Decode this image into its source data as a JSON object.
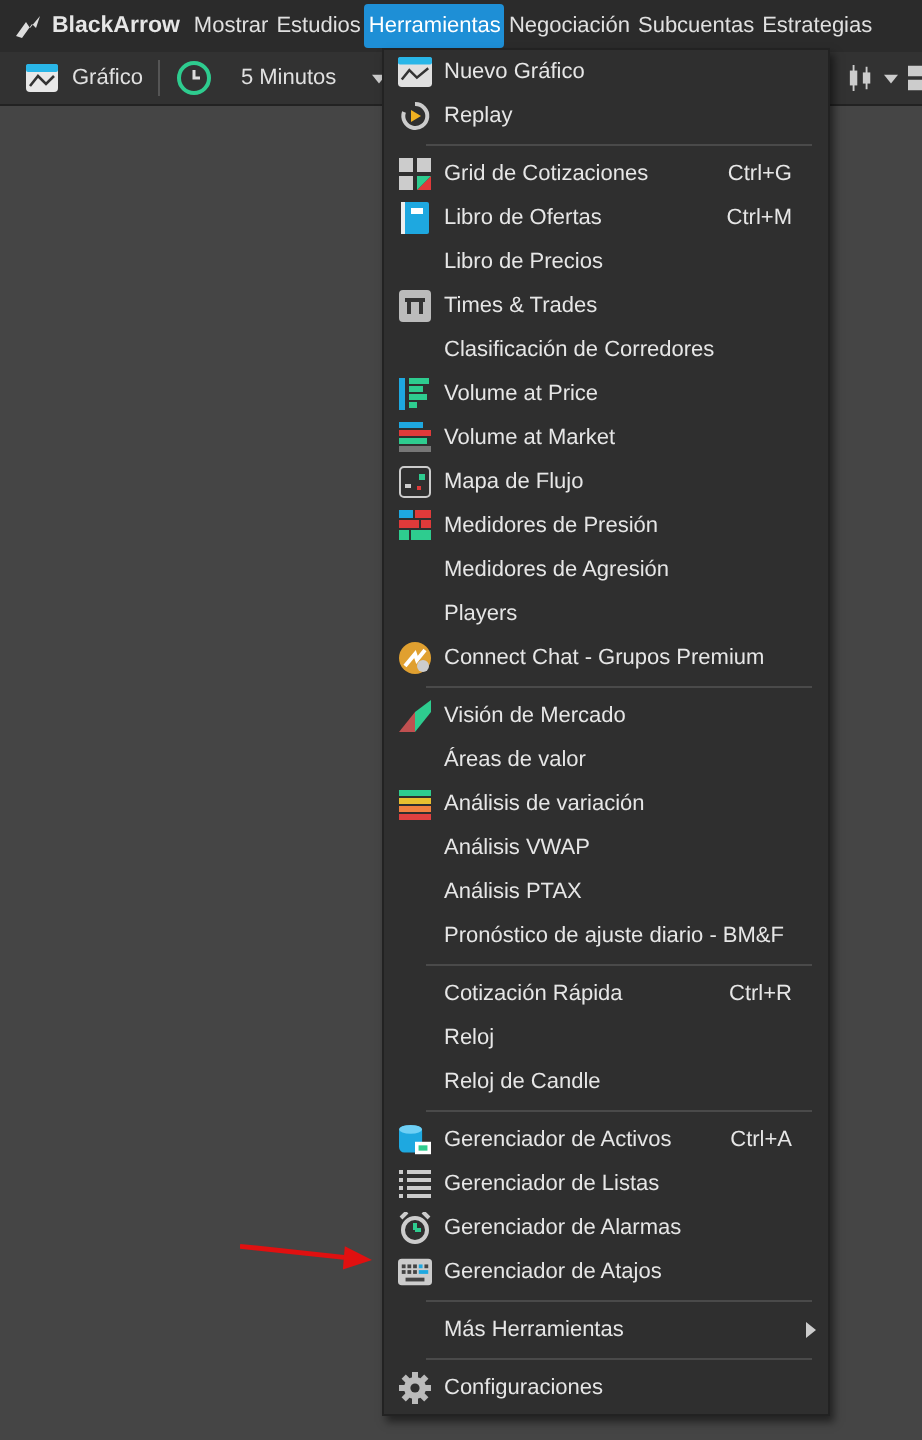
{
  "menubar": {
    "brand": "BlackArrow",
    "items": [
      {
        "label": "Mostrar",
        "selected": false
      },
      {
        "label": "Estudios",
        "selected": false
      },
      {
        "label": "Herramientas",
        "selected": true
      },
      {
        "label": "Negociación",
        "selected": false
      },
      {
        "label": "Subcuentas",
        "selected": false
      },
      {
        "label": "Estrategias",
        "selected": false
      }
    ]
  },
  "toolbar": {
    "chart_button": "Gráfico",
    "interval": "5 Minutos"
  },
  "menu": {
    "sections": [
      [
        {
          "label": "Nuevo Gráfico",
          "kind": "chart"
        },
        {
          "label": "Replay",
          "kind": "replay"
        }
      ],
      [
        {
          "label": "Grid de Cotizaciones",
          "kind": "grid",
          "shortcut": "Ctrl+G"
        },
        {
          "label": "Libro de Ofertas",
          "kind": "book",
          "shortcut": "Ctrl+M"
        },
        {
          "label": "Libro de Precios",
          "kind": "plain"
        },
        {
          "label": "Times & Trades",
          "kind": "tt"
        },
        {
          "label": "Clasificación de Corredores",
          "kind": "plain"
        },
        {
          "label": "Volume at Price",
          "kind": "vap"
        },
        {
          "label": "Volume at Market",
          "kind": "vam"
        },
        {
          "label": "Mapa de Flujo",
          "kind": "flow"
        },
        {
          "label": "Medidores de Presión",
          "kind": "pressure"
        },
        {
          "label": "Medidores de Agresión",
          "kind": "plain"
        },
        {
          "label": "Players",
          "kind": "plain"
        },
        {
          "label": "Connect Chat - Grupos Premium",
          "kind": "chat"
        }
      ],
      [
        {
          "label": "Visión de Mercado",
          "kind": "vision"
        },
        {
          "label": "Áreas de valor",
          "kind": "plain"
        },
        {
          "label": "Análisis de variación",
          "kind": "variation"
        },
        {
          "label": "Análisis VWAP",
          "kind": "plain"
        },
        {
          "label": "Análisis PTAX",
          "kind": "plain"
        },
        {
          "label": "Pronóstico de ajuste diario - BM&F",
          "kind": "plain"
        }
      ],
      [
        {
          "label": "Cotización Rápida",
          "kind": "plain",
          "shortcut": "Ctrl+R"
        },
        {
          "label": "Reloj",
          "kind": "plain"
        },
        {
          "label": "Reloj de Candle",
          "kind": "plain"
        }
      ],
      [
        {
          "label": "Gerenciador de Activos",
          "kind": "assets",
          "shortcut": "Ctrl+A"
        },
        {
          "label": "Gerenciador de Listas",
          "kind": "list"
        },
        {
          "label": "Gerenciador de Alarmas",
          "kind": "alarm"
        },
        {
          "label": "Gerenciador de Atajos",
          "kind": "keyboard"
        }
      ],
      [
        {
          "label": "Más Herramientas",
          "kind": "submenu"
        }
      ],
      [
        {
          "label": "Configuraciones",
          "kind": "gear"
        }
      ]
    ]
  }
}
